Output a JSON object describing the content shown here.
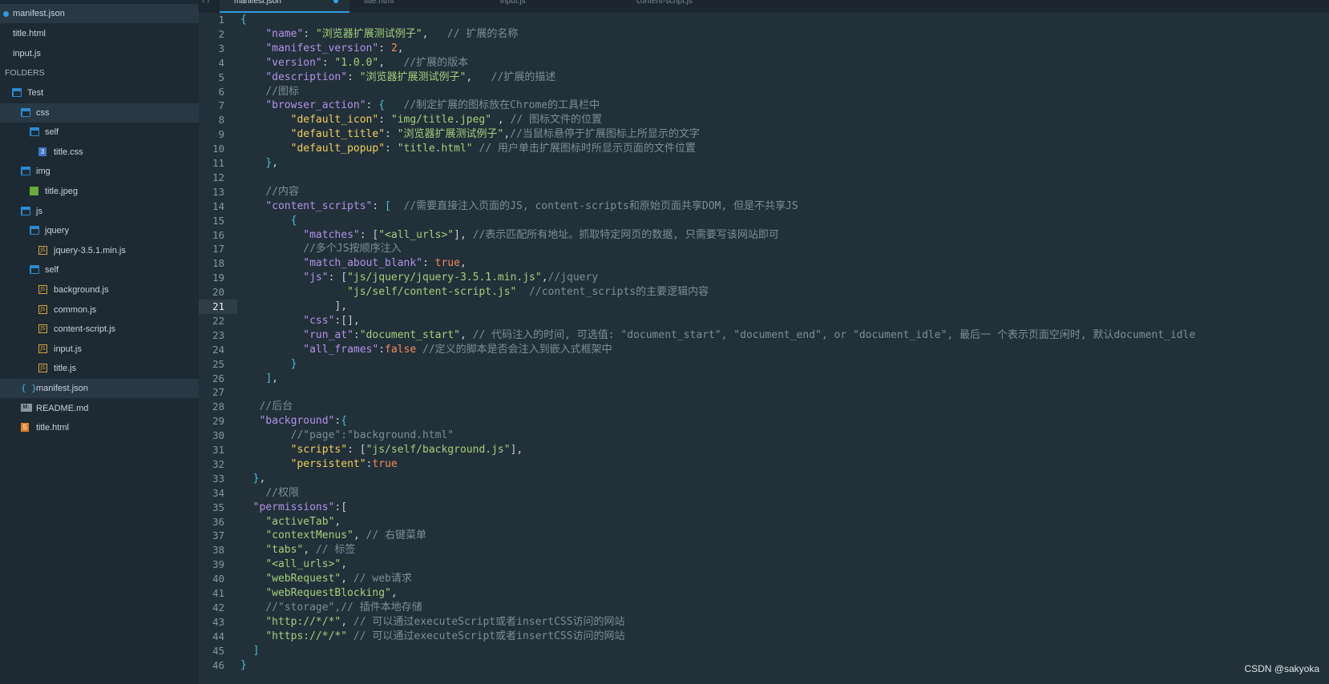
{
  "open_files": [
    {
      "label": "manifest.json",
      "active": true,
      "modified": true
    },
    {
      "label": "title.html",
      "active": false
    },
    {
      "label": "input.js",
      "active": false
    }
  ],
  "folders_label": "FOLDERS",
  "tree": [
    {
      "label": "Test",
      "icon": "folder-open-icon",
      "depth": 0
    },
    {
      "label": "css",
      "icon": "folder-open-icon",
      "depth": 1,
      "active": true
    },
    {
      "label": "self",
      "icon": "folder-open-icon",
      "depth": 2
    },
    {
      "label": "title.css",
      "icon": "css-file-icon",
      "depth": 3
    },
    {
      "label": "img",
      "icon": "folder-open-icon",
      "depth": 1
    },
    {
      "label": "title.jpeg",
      "icon": "image-file-icon",
      "depth": 2
    },
    {
      "label": "js",
      "icon": "folder-open-icon",
      "depth": 1
    },
    {
      "label": "jquery",
      "icon": "folder-open-icon",
      "depth": 2
    },
    {
      "label": "jquery-3.5.1.min.js",
      "icon": "js-file-icon",
      "depth": 3
    },
    {
      "label": "self",
      "icon": "folder-open-icon",
      "depth": 2
    },
    {
      "label": "background.js",
      "icon": "js-file-icon",
      "depth": 3
    },
    {
      "label": "common.js",
      "icon": "js-file-icon",
      "depth": 3
    },
    {
      "label": "content-script.js",
      "icon": "js-file-icon",
      "depth": 3
    },
    {
      "label": "input.js",
      "icon": "js-file-icon",
      "depth": 3
    },
    {
      "label": "title.js",
      "icon": "js-file-icon",
      "depth": 3
    },
    {
      "label": "manifest.json",
      "icon": "json-file-icon",
      "depth": 1,
      "active": true
    },
    {
      "label": "README.md",
      "icon": "markdown-file-icon",
      "depth": 1
    },
    {
      "label": "title.html",
      "icon": "html-file-icon",
      "depth": 1
    }
  ],
  "tabs": [
    {
      "label": "manifest.json",
      "active": true,
      "modified": true
    },
    {
      "label": "title.html",
      "active": false
    },
    {
      "label": "input.js",
      "active": false
    },
    {
      "label": "content-script.js",
      "active": false
    }
  ],
  "current_line": 21,
  "code": [
    [
      [
        "b",
        "{"
      ]
    ],
    [
      [
        "p",
        "    "
      ],
      [
        "k",
        "\"name\""
      ],
      [
        "p",
        ": "
      ],
      [
        "s",
        "\"浏览器扩展测试例子\""
      ],
      [
        "p",
        ",   "
      ],
      [
        "c",
        "// 扩展的名称"
      ]
    ],
    [
      [
        "p",
        "    "
      ],
      [
        "k",
        "\"manifest_version\""
      ],
      [
        "p",
        ": "
      ],
      [
        "n",
        "2"
      ],
      [
        "p",
        ","
      ]
    ],
    [
      [
        "p",
        "    "
      ],
      [
        "k",
        "\"version\""
      ],
      [
        "p",
        ": "
      ],
      [
        "s",
        "\"1.0.0\""
      ],
      [
        "p",
        ",   "
      ],
      [
        "c",
        "//扩展的版本"
      ]
    ],
    [
      [
        "p",
        "    "
      ],
      [
        "k",
        "\"description\""
      ],
      [
        "p",
        ": "
      ],
      [
        "s",
        "\"浏览器扩展测试例子\""
      ],
      [
        "p",
        ",   "
      ],
      [
        "c",
        "//扩展的描述"
      ]
    ],
    [
      [
        "p",
        "    "
      ],
      [
        "c",
        "//图标"
      ]
    ],
    [
      [
        "p",
        "    "
      ],
      [
        "k",
        "\"browser_action\""
      ],
      [
        "p",
        ": "
      ],
      [
        "b",
        "{"
      ],
      [
        "p",
        "   "
      ],
      [
        "c",
        "//制定扩展的图标放在Chrome的工具栏中"
      ]
    ],
    [
      [
        "p",
        "        "
      ],
      [
        "ky",
        "\"default_icon\""
      ],
      [
        "p",
        ": "
      ],
      [
        "s",
        "\"img/title.jpeg\""
      ],
      [
        "p",
        " , "
      ],
      [
        "c",
        "// 图标文件的位置"
      ]
    ],
    [
      [
        "p",
        "        "
      ],
      [
        "ky",
        "\"default_title\""
      ],
      [
        "p",
        ": "
      ],
      [
        "s",
        "\"浏览器扩展测试例子\""
      ],
      [
        "p",
        ","
      ],
      [
        "c",
        "//当鼠标悬停于扩展图标上所显示的文字"
      ]
    ],
    [
      [
        "p",
        "        "
      ],
      [
        "ky",
        "\"default_popup\""
      ],
      [
        "p",
        ": "
      ],
      [
        "s",
        "\"title.html\""
      ],
      [
        "p",
        " "
      ],
      [
        "c",
        "// 用户单击扩展图标时所显示页面的文件位置"
      ]
    ],
    [
      [
        "p",
        "    "
      ],
      [
        "b",
        "}"
      ],
      [
        "p",
        ","
      ]
    ],
    [
      [
        "p",
        ""
      ]
    ],
    [
      [
        "p",
        "    "
      ],
      [
        "c",
        "//内容"
      ]
    ],
    [
      [
        "p",
        "    "
      ],
      [
        "k",
        "\"content_scripts\""
      ],
      [
        "p",
        ": "
      ],
      [
        "b",
        "["
      ],
      [
        "p",
        "  "
      ],
      [
        "c",
        "//需要直接注入页面的JS, content-scripts和原始页面共享DOM, 但是不共享JS"
      ]
    ],
    [
      [
        "p",
        "        "
      ],
      [
        "b",
        "{"
      ]
    ],
    [
      [
        "p",
        "          "
      ],
      [
        "k",
        "\"matches\""
      ],
      [
        "p",
        ": ["
      ],
      [
        "s",
        "\"<all_urls>\""
      ],
      [
        "p",
        "], "
      ],
      [
        "c",
        "//表示匹配所有地址。抓取特定网页的数据, 只需要写该网站即可"
      ]
    ],
    [
      [
        "p",
        "          "
      ],
      [
        "c",
        "//多个JS按顺序注入"
      ]
    ],
    [
      [
        "p",
        "          "
      ],
      [
        "k",
        "\"match_about_blank\""
      ],
      [
        "p",
        ": "
      ],
      [
        "n",
        "true"
      ],
      [
        "p",
        ","
      ]
    ],
    [
      [
        "p",
        "          "
      ],
      [
        "k",
        "\"js\""
      ],
      [
        "p",
        ": ["
      ],
      [
        "s",
        "\"js/jquery/jquery-3.5.1.min.js\""
      ],
      [
        "p",
        ","
      ],
      [
        "c",
        "//jquery"
      ]
    ],
    [
      [
        "p",
        "                 "
      ],
      [
        "s",
        "\"js/self/content-script.js\""
      ],
      [
        "p",
        "  "
      ],
      [
        "c",
        "//content_scripts的主要逻辑内容"
      ]
    ],
    [
      [
        "p",
        "               ],"
      ]
    ],
    [
      [
        "p",
        "          "
      ],
      [
        "k",
        "\"css\""
      ],
      [
        "p",
        ":[],"
      ]
    ],
    [
      [
        "p",
        "          "
      ],
      [
        "k",
        "\"run_at\""
      ],
      [
        "p",
        ":"
      ],
      [
        "s",
        "\"document_start\""
      ],
      [
        "p",
        ", "
      ],
      [
        "c",
        "// 代码注入的时间, 可选值: \"document_start\", \"document_end\", or \"document_idle\", 最后一 个表示页面空闲时, 默认document_idle"
      ]
    ],
    [
      [
        "p",
        "          "
      ],
      [
        "k",
        "\"all_frames\""
      ],
      [
        "p",
        ":"
      ],
      [
        "n",
        "false"
      ],
      [
        "p",
        " "
      ],
      [
        "c",
        "//定义的脚本是否会注入到嵌入式框架中"
      ]
    ],
    [
      [
        "p",
        "        "
      ],
      [
        "b",
        "}"
      ]
    ],
    [
      [
        "p",
        "    "
      ],
      [
        "b",
        "]"
      ],
      [
        "p",
        ","
      ]
    ],
    [
      [
        "p",
        ""
      ]
    ],
    [
      [
        "p",
        "   "
      ],
      [
        "c",
        "//后台"
      ]
    ],
    [
      [
        "p",
        "   "
      ],
      [
        "k",
        "\"background\""
      ],
      [
        "p",
        ":"
      ],
      [
        "b",
        "{"
      ]
    ],
    [
      [
        "p",
        "        "
      ],
      [
        "c",
        "//\"page\":\"background.html\""
      ]
    ],
    [
      [
        "p",
        "        "
      ],
      [
        "ky",
        "\"scripts\""
      ],
      [
        "p",
        ": ["
      ],
      [
        "s",
        "\"js/self/background.js\""
      ],
      [
        "p",
        "],"
      ]
    ],
    [
      [
        "p",
        "        "
      ],
      [
        "ky",
        "\"persistent\""
      ],
      [
        "p",
        ":"
      ],
      [
        "n",
        "true"
      ]
    ],
    [
      [
        "p",
        "  "
      ],
      [
        "b",
        "}"
      ],
      [
        "p",
        ","
      ]
    ],
    [
      [
        "p",
        "    "
      ],
      [
        "c",
        "//权限"
      ]
    ],
    [
      [
        "p",
        "  "
      ],
      [
        "k",
        "\"permissions\""
      ],
      [
        "p",
        ":["
      ]
    ],
    [
      [
        "p",
        "    "
      ],
      [
        "s",
        "\"activeTab\""
      ],
      [
        "p",
        ","
      ]
    ],
    [
      [
        "p",
        "    "
      ],
      [
        "s",
        "\"contextMenus\""
      ],
      [
        "p",
        ", "
      ],
      [
        "c",
        "// 右键菜单"
      ]
    ],
    [
      [
        "p",
        "    "
      ],
      [
        "s",
        "\"tabs\""
      ],
      [
        "p",
        ", "
      ],
      [
        "c",
        "// 标签"
      ]
    ],
    [
      [
        "p",
        "    "
      ],
      [
        "s",
        "\"<all_urls>\""
      ],
      [
        "p",
        ","
      ]
    ],
    [
      [
        "p",
        "    "
      ],
      [
        "s",
        "\"webRequest\""
      ],
      [
        "p",
        ", "
      ],
      [
        "c",
        "// web请求"
      ]
    ],
    [
      [
        "p",
        "    "
      ],
      [
        "s",
        "\"webRequestBlocking\""
      ],
      [
        "p",
        ","
      ]
    ],
    [
      [
        "p",
        "    "
      ],
      [
        "c",
        "//\"storage\",// 插件本地存储"
      ]
    ],
    [
      [
        "p",
        "    "
      ],
      [
        "s",
        "\"http://*/*\""
      ],
      [
        "p",
        ", "
      ],
      [
        "c",
        "// 可以通过executeScript或者insertCSS访问的网站"
      ]
    ],
    [
      [
        "p",
        "    "
      ],
      [
        "s",
        "\"https://*/*\""
      ],
      [
        "p",
        " "
      ],
      [
        "c",
        "// 可以通过executeScript或者insertCSS访问的网站"
      ]
    ],
    [
      [
        "p",
        "  "
      ],
      [
        "b",
        "]"
      ]
    ],
    [
      [
        "b",
        "}"
      ]
    ]
  ],
  "watermark": "CSDN @sakyoka"
}
